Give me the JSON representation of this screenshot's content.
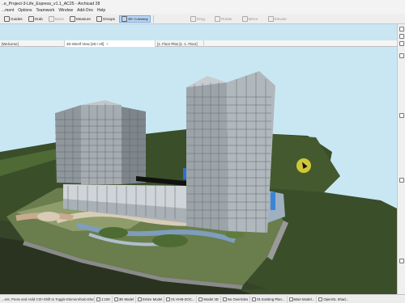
{
  "window": {
    "title": "..e_Project-3-Life_Express_v1.1_AC25 - Archicad 28"
  },
  "menu": [
    "...ment",
    "Options",
    "Teamwork",
    "Window",
    "Add-Ons",
    "Help"
  ],
  "toolbar": {
    "guides": "Guides",
    "grab": "Grab",
    "move": "Move",
    "measure": "Measure",
    "groups": "Groups",
    "cutaway": "3D Cutaway",
    "drag": "Drag",
    "rotate": "Rotate",
    "mirror": "Mirror",
    "elevate": "Elevate"
  },
  "tabs": [
    {
      "label": "[Welcome]"
    },
    {
      "label": "3D Wirelf View [3D / All]"
    },
    {
      "label": "[1. Floor Plan [1. 1. Floor]"
    }
  ],
  "statusbar": {
    "hint": "...ent, Press and Hold Ctrl+Shift to Toggle Element/Sub-Element Selection.",
    "items": [
      {
        "icon": "undo-icon",
        "label": "1:100"
      },
      {
        "icon": "layers-icon",
        "label": "3D Model"
      },
      {
        "icon": "pen-icon",
        "label": "Entire Model"
      },
      {
        "icon": "pen-set-icon",
        "label": "01 HHB-ZOC..."
      },
      {
        "icon": "model-view-icon",
        "label": "Model 3D"
      },
      {
        "icon": "graphic-override-icon",
        "label": "No Overrides"
      },
      {
        "icon": "renovation-icon",
        "label": "01 Existing Plan..."
      },
      {
        "icon": "camera-icon",
        "label": "Main Model..."
      },
      {
        "icon": "opengl-icon",
        "label": "OpenGL Shad..."
      }
    ]
  }
}
